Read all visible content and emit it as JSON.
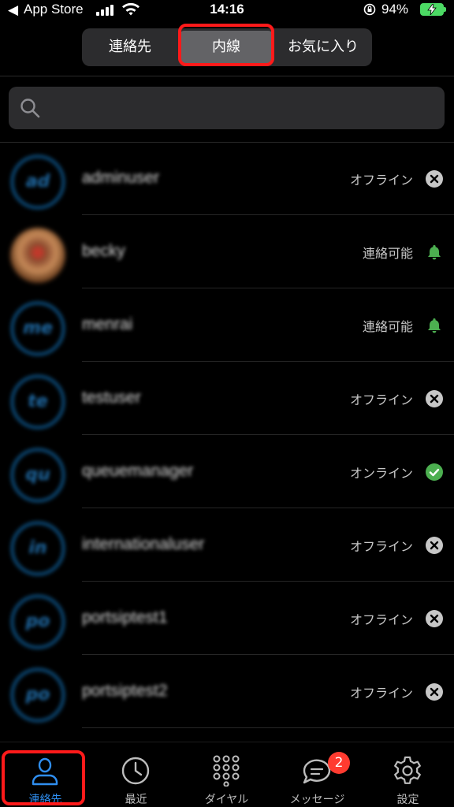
{
  "status_bar": {
    "back_arrow": "◀",
    "carrier": "App Store",
    "time": "14:16",
    "battery_percent": "94%",
    "battery_color": "#4cd964"
  },
  "segments": [
    {
      "label": "連絡先",
      "selected": false
    },
    {
      "label": "内線",
      "selected": true
    },
    {
      "label": "お気に入り",
      "selected": false
    }
  ],
  "search": {
    "placeholder": "",
    "icon": "search-icon"
  },
  "contacts": [
    {
      "initials": "ad",
      "name": "adminuser",
      "status": "オフライン",
      "status_icon": "offline-x-icon"
    },
    {
      "initials": "",
      "name": "becky",
      "status": "連絡可能",
      "status_icon": "available-bell-icon"
    },
    {
      "initials": "me",
      "name": "menrai",
      "status": "連絡可能",
      "status_icon": "available-bell-icon"
    },
    {
      "initials": "te",
      "name": "testuser",
      "status": "オフライン",
      "status_icon": "offline-x-icon"
    },
    {
      "initials": "qu",
      "name": "queuemanager",
      "status": "オンライン",
      "status_icon": "online-check-icon"
    },
    {
      "initials": "in",
      "name": "internationaluser",
      "status": "オフライン",
      "status_icon": "offline-x-icon"
    },
    {
      "initials": "po",
      "name": "portsiptest1",
      "status": "オフライン",
      "status_icon": "offline-x-icon"
    },
    {
      "initials": "po",
      "name": "portsiptest2",
      "status": "オフライン",
      "status_icon": "offline-x-icon"
    }
  ],
  "tabs": [
    {
      "label": "連絡先",
      "icon": "person-icon",
      "active": true
    },
    {
      "label": "最近",
      "icon": "clock-icon",
      "active": false
    },
    {
      "label": "ダイヤル",
      "icon": "keypad-icon",
      "active": false
    },
    {
      "label": "メッセージ",
      "icon": "message-icon",
      "active": false,
      "badge": "2"
    },
    {
      "label": "設定",
      "icon": "gear-icon",
      "active": false
    }
  ],
  "colors": {
    "accent": "#2f8ef0",
    "highlight": "#ff1a1a",
    "online": "#4caf50",
    "badge": "#ff3b30"
  }
}
